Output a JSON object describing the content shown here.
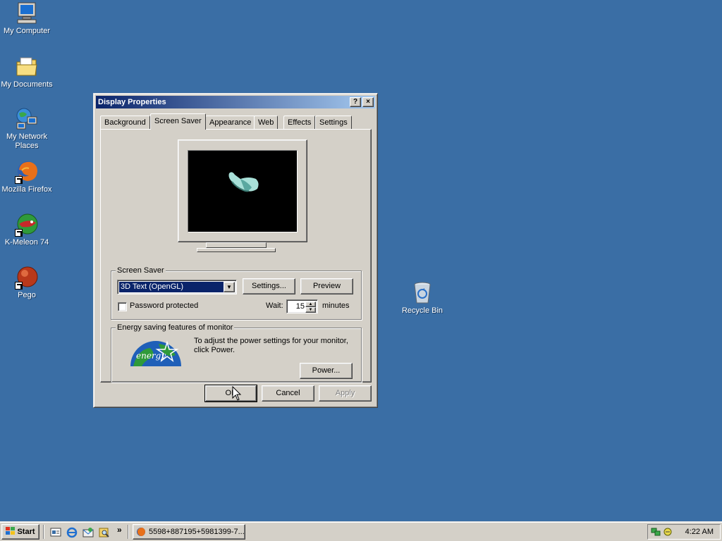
{
  "desktop": {
    "icons": [
      {
        "label": "My Computer"
      },
      {
        "label": "My Documents"
      },
      {
        "label": "My Network Places"
      },
      {
        "label": "Mozilla Firefox"
      },
      {
        "label": "K-Meleon 74"
      },
      {
        "label": "Pego"
      },
      {
        "label": "Recycle Bin"
      }
    ]
  },
  "window": {
    "title": "Display Properties",
    "help_btn": "?",
    "close_btn": "×",
    "tabs": [
      {
        "label": "Background"
      },
      {
        "label": "Screen Saver"
      },
      {
        "label": "Appearance"
      },
      {
        "label": "Web"
      },
      {
        "label": "Effects"
      },
      {
        "label": "Settings"
      }
    ],
    "active_tab": "Screen Saver",
    "screen_saver": {
      "group_label": "Screen Saver",
      "selected": "3D Text (OpenGL)",
      "settings_btn": "Settings...",
      "preview_btn": "Preview",
      "password_label": "Password protected",
      "password_checked": false,
      "wait_label": "Wait:",
      "wait_value": "15",
      "wait_unit": "minutes"
    },
    "energy": {
      "group_label": "Energy saving features of monitor",
      "text": "To adjust the power settings for your monitor, click Power.",
      "power_btn": "Power...",
      "logo_text": "energy"
    },
    "ok_btn": "OK",
    "cancel_btn": "Cancel",
    "apply_btn": "Apply"
  },
  "taskbar": {
    "start_label": "Start",
    "task_label": "5598+887195+5981399-7...",
    "chevron": "»",
    "clock": "4:22 AM"
  },
  "colors": {
    "desktop": "#3a6ea5",
    "face": "#d4d0c8",
    "title_start": "#0a246a",
    "title_end": "#a6caf0"
  }
}
